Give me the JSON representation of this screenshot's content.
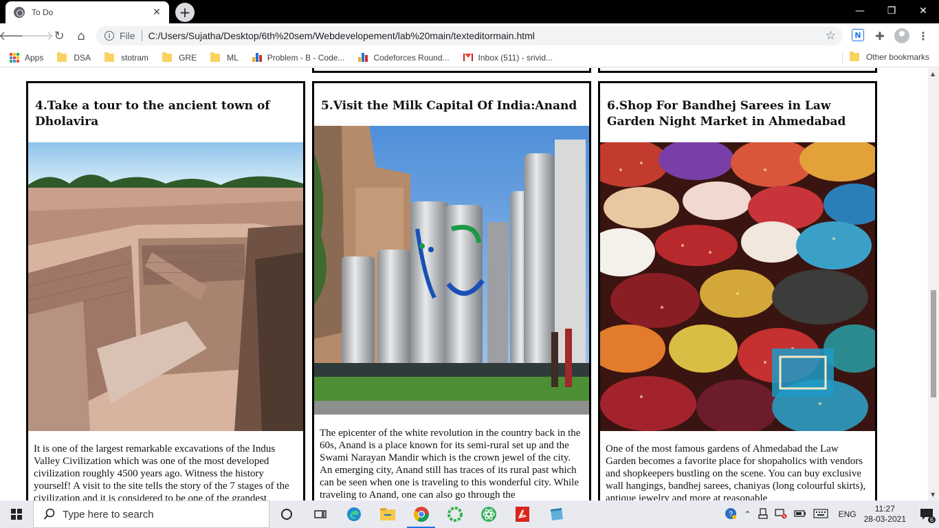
{
  "browser": {
    "tab_title": "To Do",
    "url_scheme": "File",
    "url": "C:/Users/Sujatha/Desktop/6th%20sem/Webdevelopement/lab%20main/texteditormain.html"
  },
  "bookmarks": {
    "items": [
      {
        "label": "Apps",
        "icon": "apps-grid-icon"
      },
      {
        "label": "DSA",
        "icon": "folder-icon"
      },
      {
        "label": "stotram",
        "icon": "folder-icon"
      },
      {
        "label": "GRE",
        "icon": "folder-icon"
      },
      {
        "label": "ML",
        "icon": "folder-icon"
      },
      {
        "label": "Problem - B - Code...",
        "icon": "codeforces-icon"
      },
      {
        "label": "Codeforces Round...",
        "icon": "codeforces-icon"
      },
      {
        "label": "Inbox (511) - srivid...",
        "icon": "gmail-icon"
      }
    ],
    "other": "Other bookmarks"
  },
  "cards": [
    {
      "title": "4.Take a tour to the ancient town of Dholavira",
      "image": "dholavira-excavation-image",
      "text": "It is one of the largest remarkable excavations of the Indus Valley Civilization which was one of the most developed civilization roughly 4500 years ago. Witness the history yourself! A visit to the site tells the story of the 7 stages of the civilization and it is considered to be one of the grandest"
    },
    {
      "title": "5.Visit the Milk Capital Of India:Anand",
      "image": "anand-milk-plant-image",
      "text": "The epicenter of the white revolution in the country back in the 60s, Anand is a place known for its semi-rural set up and the Swami Narayan Mandir which is the crown jewel of the city. An emerging city, Anand still has traces of its rural past which can be seen when one is traveling to this wonderful city. While traveling to Anand, one can also go through the"
    },
    {
      "title": "6.Shop For Bandhej Sarees in Law Garden Night Market in Ahmedabad",
      "image": "bandhej-sarees-image",
      "text": "One of the most famous gardens of Ahmedabad the Law Garden becomes a favorite place for shopaholics with vendors and shopkeepers bustling on the scene. You can buy exclusive wall hangings, bandhej sarees, chaniyas (long colourful skirts), antique jewelry and more at reasonable"
    }
  ],
  "taskbar": {
    "search_placeholder": "Type here to search",
    "language": "ENG",
    "time": "11:27",
    "date": "28-03-2021",
    "notification_count": "6"
  }
}
